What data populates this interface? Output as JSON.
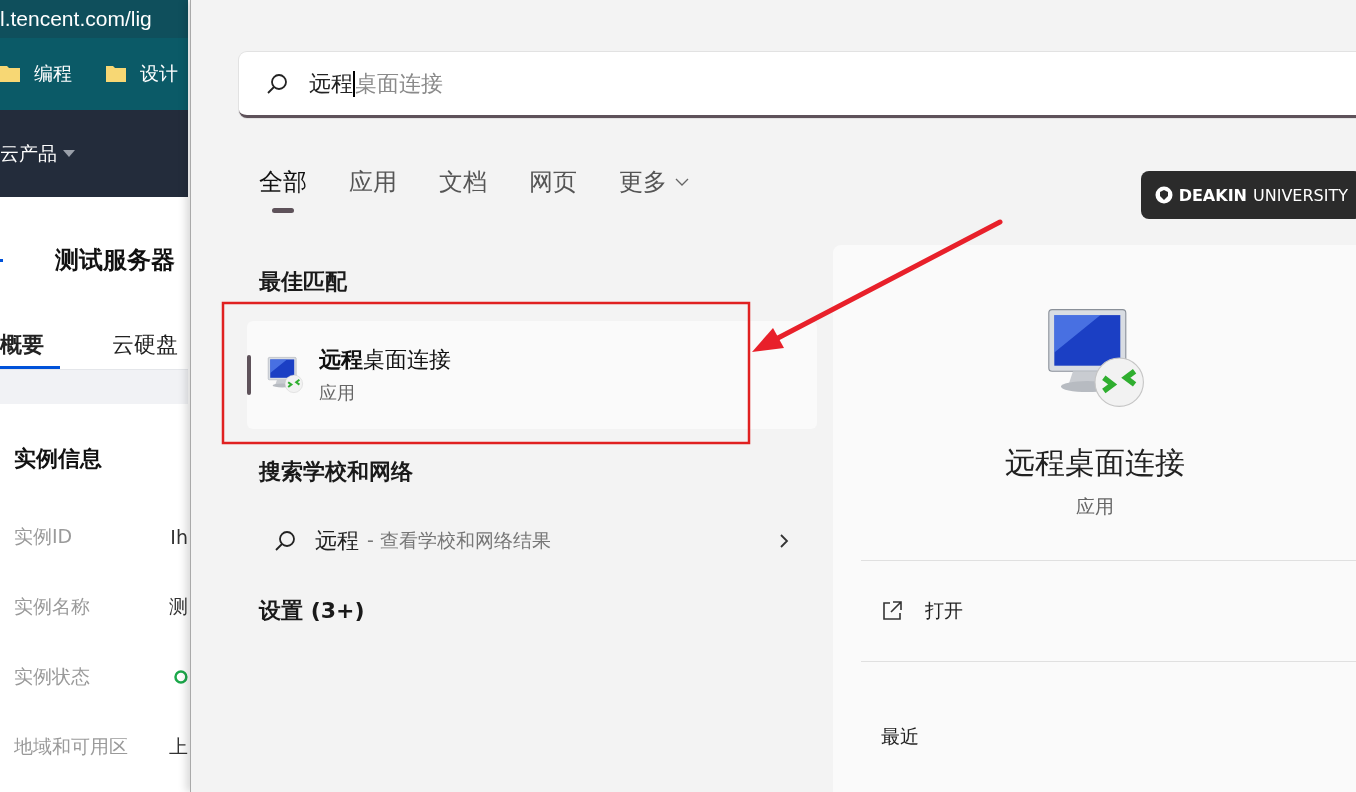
{
  "browser": {
    "address": "l.tencent.com/lig",
    "bookmarks": [
      {
        "label": "编程"
      },
      {
        "label": "设计"
      }
    ],
    "nav": {
      "label": "云产品"
    },
    "page_title": "测试服务器",
    "tabs": [
      {
        "label": "概要",
        "selected": true
      },
      {
        "label": "云硬盘",
        "selected": false
      }
    ],
    "section_title": "实例信息",
    "fields": [
      {
        "kind": "text",
        "label": "实例ID",
        "value": "Ih"
      },
      {
        "kind": "text",
        "label": "实例名称",
        "value": "测"
      },
      {
        "kind": "status",
        "label": "实例状态"
      },
      {
        "kind": "text",
        "label": "地域和可用区",
        "value": "上"
      }
    ]
  },
  "search": {
    "field": {
      "value": "远程",
      "completion": "桌面连接"
    },
    "tabs": [
      {
        "label": "全部",
        "selected": true,
        "has_menu": false
      },
      {
        "label": "应用",
        "selected": false,
        "has_menu": false
      },
      {
        "label": "文档",
        "selected": false,
        "has_menu": false
      },
      {
        "label": "网页",
        "selected": false,
        "has_menu": false
      },
      {
        "label": "更多",
        "selected": false,
        "has_menu": true
      }
    ],
    "badge": {
      "bold": "DEAKIN",
      "text": "UNIVERSITY"
    },
    "best_match": {
      "heading": "最佳匹配",
      "item": {
        "title": "**远程**桌面连接",
        "subtitle": "应用",
        "selected": true
      }
    },
    "web": {
      "heading": "搜索学校和网络",
      "item": {
        "query": "远程",
        "hint": "- 查看学校和网络结果"
      }
    },
    "settings": {
      "heading": "设置 (3+)"
    },
    "detail": {
      "title": "远程桌面连接",
      "subtitle": "应用",
      "actions": [
        {
          "label": "打开"
        }
      ],
      "recent_heading": "最近"
    }
  }
}
